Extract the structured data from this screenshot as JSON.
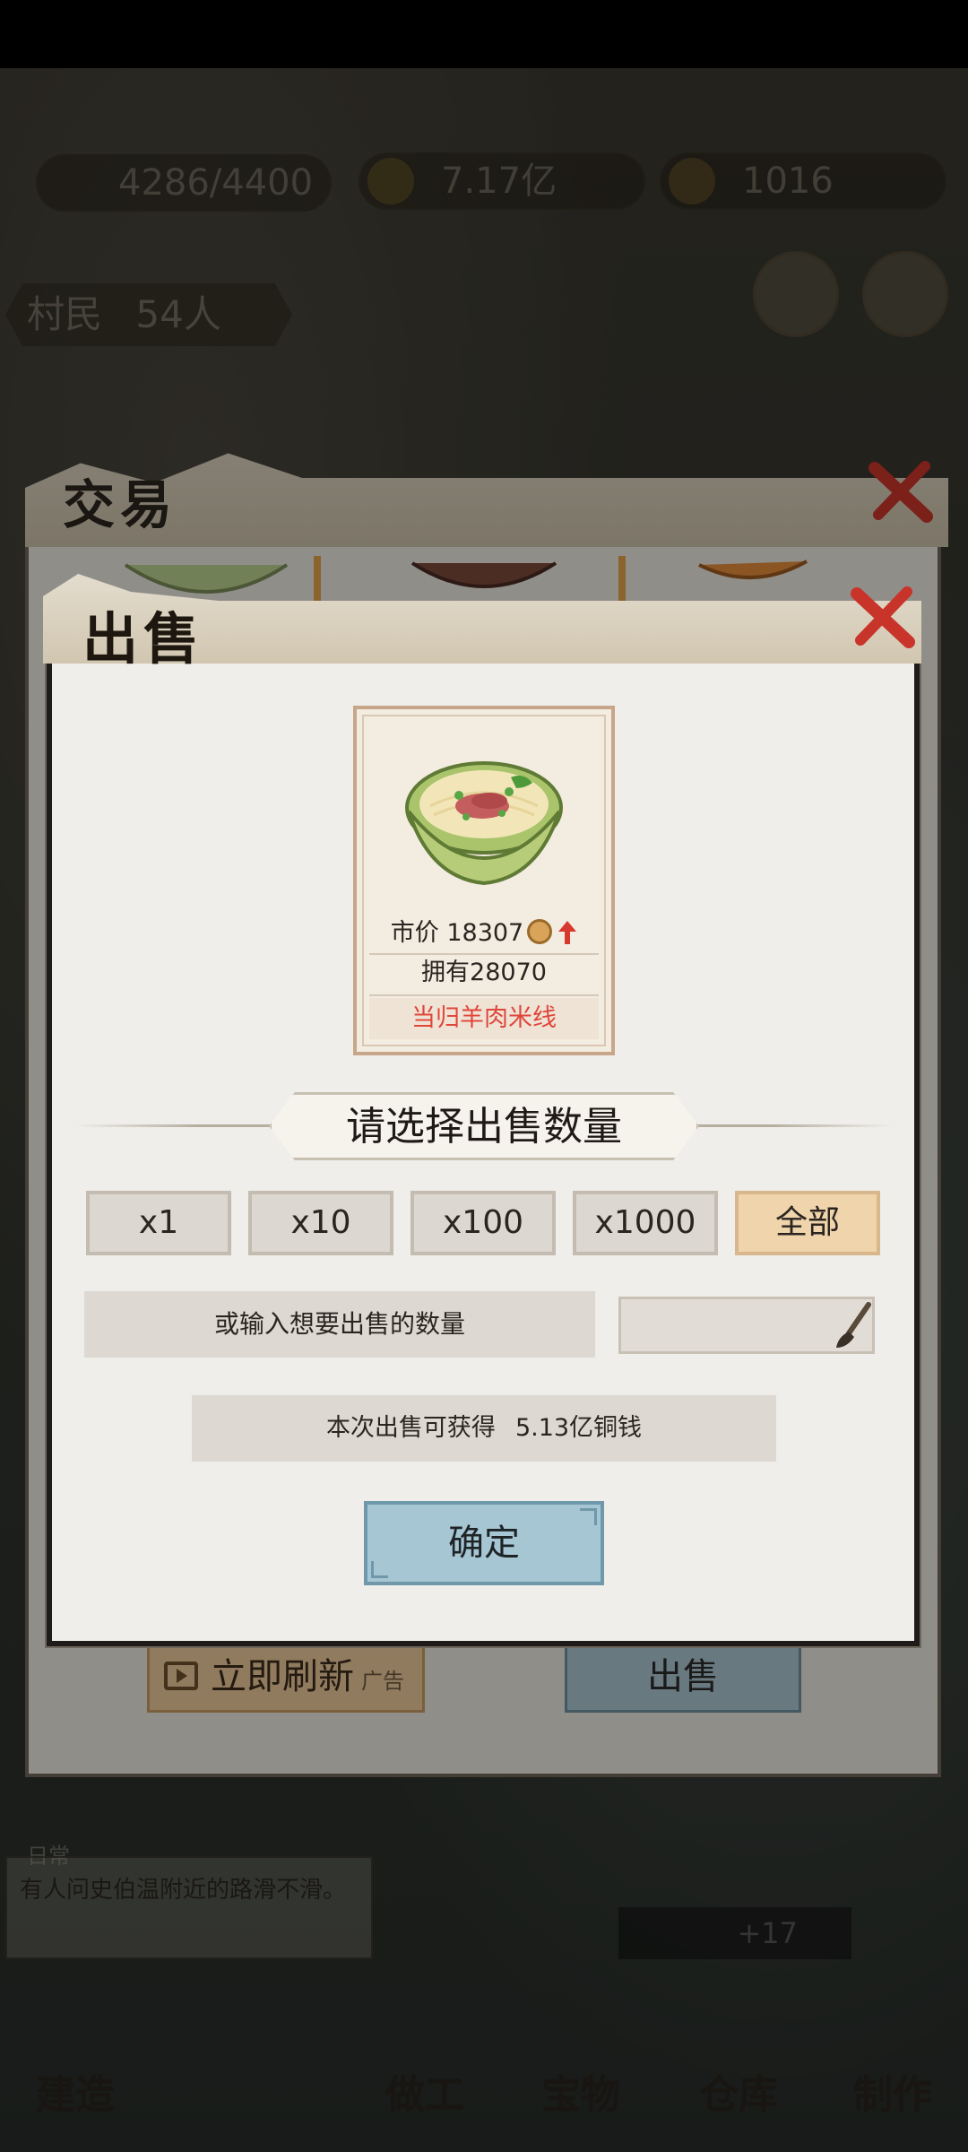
{
  "hud": {
    "population": "4286/4400",
    "money": "7.17亿",
    "gold": "1016",
    "villagers_label": "村民",
    "villagers_count": "54人"
  },
  "news": {
    "tag": "日常",
    "text": "有人问史伯温附近的路滑不滑。"
  },
  "bottom_nav": {
    "build": "建造",
    "work": "做工",
    "treasure": "宝物",
    "warehouse": "仓库",
    "craft": "制作"
  },
  "notification_count": "+17",
  "trade_panel": {
    "title": "交易",
    "refresh_label": "立即刷新",
    "refresh_ad": "广告",
    "sell_label": "出售"
  },
  "sell_dialog": {
    "title": "出售",
    "item": {
      "price_label": "市价 18307",
      "owned_label": "拥有28070",
      "name": "当归羊肉米线"
    },
    "select_heading": "请选择出售数量",
    "quantity_options": [
      "x1",
      "x10",
      "x100",
      "x1000",
      "全部"
    ],
    "selected_option": "全部",
    "input_label": "或输入想要出售的数量",
    "input_value": "",
    "earn_prefix": "本次出售可获得",
    "earn_amount": "5.13亿铜钱",
    "confirm_label": "确定"
  },
  "colors": {
    "accent_red": "#e0463a",
    "confirm_blue": "#a6c6d3",
    "selected_tan": "#efd4ac"
  }
}
